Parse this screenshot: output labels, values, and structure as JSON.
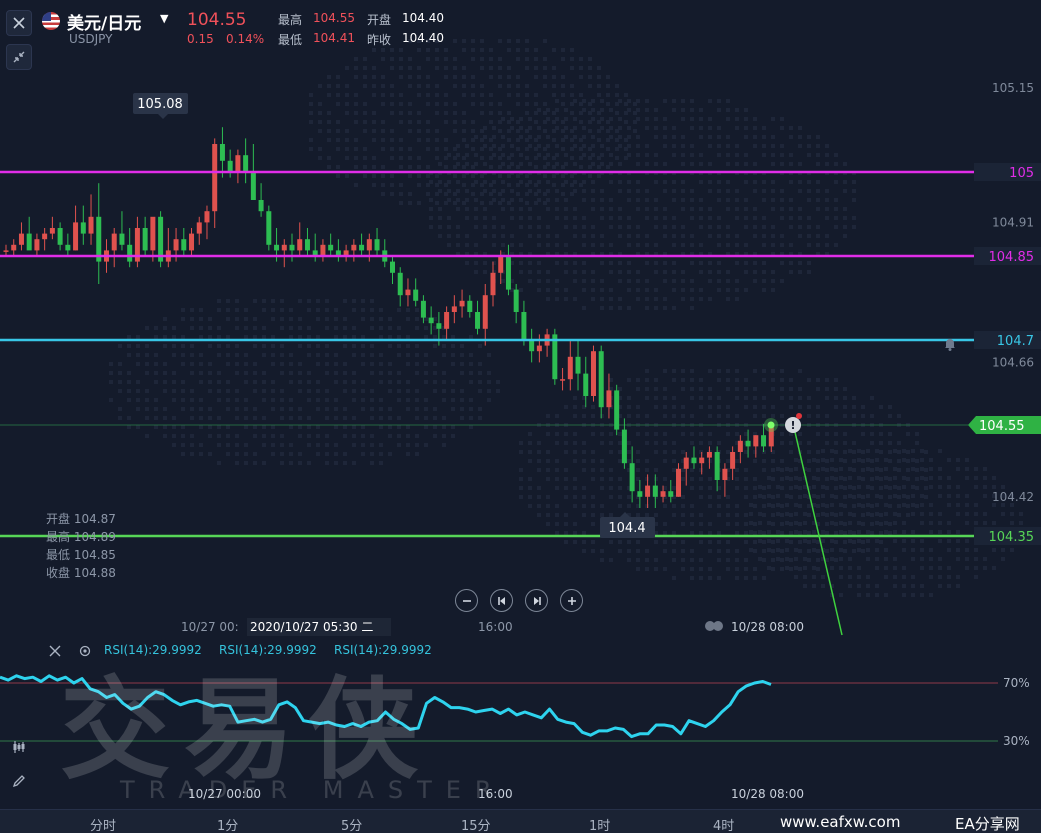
{
  "symbol": {
    "name": "美元/日元",
    "code": "USDJPY",
    "last_price": "104.55",
    "change": "0.15",
    "change_pct": "0.14%"
  },
  "stats": [
    {
      "label": "最高",
      "value": "104.55",
      "color": "#f0515a"
    },
    {
      "label": "开盘",
      "value": "104.40",
      "color": "#ffffff"
    },
    {
      "label": "最低",
      "value": "104.41",
      "color": "#f0515a"
    },
    {
      "label": "昨收",
      "value": "104.40",
      "color": "#ffffff"
    }
  ],
  "colors": {
    "up": "#e0524e",
    "down": "#2dbd52",
    "background": "#141b2b",
    "magenta_line": "#e02de8",
    "cyan_line": "#38c6e6",
    "green_line": "#57d657",
    "rsi": "#2ed3ee"
  },
  "price_axis": {
    "ticks": [
      "105.15",
      "104.91",
      "104.66",
      "104.42"
    ],
    "tick_values": [
      105.15,
      104.91,
      104.66,
      104.42
    ]
  },
  "h_lines": [
    {
      "label": "105",
      "value": 105.0,
      "color": "#e02de8"
    },
    {
      "label": "104.85",
      "value": 104.85,
      "color": "#e02de8"
    },
    {
      "label": "104.7",
      "value": 104.7,
      "color": "#38c6e6"
    },
    {
      "label": "104.35",
      "value": 104.35,
      "color": "#57d657"
    }
  ],
  "current_price_tag": "104.55",
  "high_marker": "105.08",
  "low_marker": "104.4",
  "ohlc": {
    "open": {
      "label": "开盘",
      "value": "104.87"
    },
    "high": {
      "label": "最高",
      "value": "104.89"
    },
    "low": {
      "label": "最低",
      "value": "104.85"
    },
    "close": {
      "label": "收盘",
      "value": "104.88"
    }
  },
  "time_axis": {
    "left": "10/27 00:",
    "cursor": "2020/10/27 05:30 二",
    "mid": "16:00",
    "right": "10/28 08:00"
  },
  "rsi": {
    "labels": [
      "RSI(14):29.9992",
      "RSI(14):29.9992",
      "RSI(14):29.9992"
    ],
    "levels": [
      "70%",
      "30%"
    ],
    "time_labels": [
      "10/27 00:00",
      "16:00",
      "10/28 08:00"
    ],
    "values": [
      74,
      72,
      75,
      73,
      74,
      71,
      75,
      72,
      74,
      70,
      73,
      66,
      64,
      60,
      62,
      56,
      52,
      54,
      60,
      64,
      62,
      58,
      55,
      57,
      58,
      56,
      54,
      55,
      54,
      43,
      44,
      45,
      43,
      45,
      55,
      57,
      53,
      44,
      43,
      42,
      43,
      41,
      40,
      42,
      40,
      43,
      44,
      50,
      45,
      42,
      38,
      39,
      56,
      60,
      57,
      53,
      53,
      52,
      50,
      51,
      52,
      49,
      52,
      48,
      50,
      48,
      46,
      52,
      45,
      43,
      42,
      36,
      34,
      37,
      37,
      39,
      38,
      33,
      35,
      35,
      41,
      41,
      40,
      35,
      44,
      42,
      40,
      44,
      50,
      55,
      64,
      68,
      70,
      71,
      69
    ]
  },
  "candles": [
    [
      104.86,
      104.87,
      104.85,
      104.86
    ],
    [
      104.86,
      104.88,
      104.85,
      104.87
    ],
    [
      104.87,
      104.91,
      104.86,
      104.89
    ],
    [
      104.89,
      104.92,
      104.87,
      104.86
    ],
    [
      104.86,
      104.89,
      104.85,
      104.88
    ],
    [
      104.88,
      104.9,
      104.86,
      104.89
    ],
    [
      104.89,
      104.92,
      104.88,
      104.9
    ],
    [
      104.9,
      104.91,
      104.86,
      104.87
    ],
    [
      104.87,
      104.89,
      104.85,
      104.86
    ],
    [
      104.86,
      104.94,
      104.86,
      104.91
    ],
    [
      104.91,
      104.94,
      104.87,
      104.89
    ],
    [
      104.89,
      104.96,
      104.87,
      104.92
    ],
    [
      104.92,
      104.98,
      104.8,
      104.84
    ],
    [
      104.84,
      104.88,
      104.82,
      104.86
    ],
    [
      104.86,
      104.9,
      104.83,
      104.89
    ],
    [
      104.89,
      104.93,
      104.86,
      104.87
    ],
    [
      104.87,
      104.9,
      104.83,
      104.84
    ],
    [
      104.84,
      104.92,
      104.83,
      104.9
    ],
    [
      104.9,
      104.92,
      104.85,
      104.86
    ],
    [
      104.86,
      104.91,
      104.84,
      104.92
    ],
    [
      104.92,
      104.93,
      104.83,
      104.84
    ],
    [
      104.84,
      104.9,
      104.83,
      104.86
    ],
    [
      104.86,
      104.9,
      104.84,
      104.88
    ],
    [
      104.88,
      104.9,
      104.85,
      104.86
    ],
    [
      104.86,
      104.9,
      104.85,
      104.89
    ],
    [
      104.89,
      104.92,
      104.87,
      104.91
    ],
    [
      104.91,
      104.94,
      104.88,
      104.93
    ],
    [
      104.93,
      105.06,
      104.9,
      105.05
    ],
    [
      105.05,
      105.08,
      104.99,
      105.02
    ],
    [
      105.02,
      105.04,
      104.99,
      105.0
    ],
    [
      105.0,
      105.04,
      104.98,
      105.03
    ],
    [
      105.03,
      105.06,
      104.98,
      105.0
    ],
    [
      105.0,
      105.05,
      104.95,
      104.95
    ],
    [
      104.95,
      104.98,
      104.92,
      104.93
    ],
    [
      104.93,
      104.94,
      104.86,
      104.87
    ],
    [
      104.87,
      104.9,
      104.84,
      104.86
    ],
    [
      104.86,
      104.88,
      104.83,
      104.87
    ],
    [
      104.87,
      104.89,
      104.84,
      104.86
    ],
    [
      104.86,
      104.91,
      104.85,
      104.88
    ],
    [
      104.88,
      104.9,
      104.85,
      104.86
    ],
    [
      104.86,
      104.89,
      104.84,
      104.85
    ],
    [
      104.85,
      104.88,
      104.84,
      104.87
    ],
    [
      104.87,
      104.89,
      104.85,
      104.86
    ],
    [
      104.86,
      104.88,
      104.84,
      104.85
    ],
    [
      104.85,
      104.87,
      104.84,
      104.86
    ],
    [
      104.86,
      104.88,
      104.84,
      104.87
    ],
    [
      104.87,
      104.89,
      104.85,
      104.86
    ],
    [
      104.86,
      104.89,
      104.84,
      104.88
    ],
    [
      104.88,
      104.9,
      104.85,
      104.86
    ],
    [
      104.86,
      104.88,
      104.83,
      104.84
    ],
    [
      104.84,
      104.85,
      104.8,
      104.82
    ],
    [
      104.82,
      104.83,
      104.76,
      104.78
    ],
    [
      104.78,
      104.81,
      104.76,
      104.79
    ],
    [
      104.79,
      104.81,
      104.76,
      104.77
    ],
    [
      104.77,
      104.78,
      104.73,
      104.74
    ],
    [
      104.74,
      104.76,
      104.71,
      104.73
    ],
    [
      104.73,
      104.75,
      104.69,
      104.72
    ],
    [
      104.72,
      104.76,
      104.7,
      104.75
    ],
    [
      104.75,
      104.78,
      104.73,
      104.76
    ],
    [
      104.76,
      104.79,
      104.74,
      104.77
    ],
    [
      104.77,
      104.78,
      104.74,
      104.75
    ],
    [
      104.75,
      104.77,
      104.71,
      104.72
    ],
    [
      104.72,
      104.8,
      104.69,
      104.78
    ],
    [
      104.78,
      104.84,
      104.76,
      104.82
    ],
    [
      104.82,
      104.86,
      104.8,
      104.85
    ],
    [
      104.85,
      104.87,
      104.78,
      104.79
    ],
    [
      104.79,
      104.8,
      104.73,
      104.75
    ],
    [
      104.75,
      104.77,
      104.69,
      104.7
    ],
    [
      104.7,
      104.72,
      104.66,
      104.68
    ],
    [
      104.68,
      104.71,
      104.66,
      104.69
    ],
    [
      104.69,
      104.72,
      104.67,
      104.71
    ],
    [
      104.71,
      104.72,
      104.62,
      104.63
    ],
    [
      104.63,
      104.65,
      104.61,
      104.63
    ],
    [
      104.63,
      104.7,
      104.61,
      104.67
    ],
    [
      104.67,
      104.7,
      104.61,
      104.64
    ],
    [
      104.64,
      104.67,
      104.58,
      104.6
    ],
    [
      104.6,
      104.69,
      104.59,
      104.68
    ],
    [
      104.68,
      104.69,
      104.56,
      104.58
    ],
    [
      104.58,
      104.64,
      104.56,
      104.61
    ],
    [
      104.61,
      104.62,
      104.53,
      104.54
    ],
    [
      104.54,
      104.56,
      104.47,
      104.48
    ],
    [
      104.48,
      104.51,
      104.41,
      104.43
    ],
    [
      104.43,
      104.45,
      104.4,
      104.42
    ],
    [
      104.42,
      104.46,
      104.4,
      104.44
    ],
    [
      104.44,
      104.46,
      104.4,
      104.42
    ],
    [
      104.42,
      104.44,
      104.41,
      104.43
    ],
    [
      104.43,
      104.45,
      104.41,
      104.42
    ],
    [
      104.42,
      104.48,
      104.42,
      104.47
    ],
    [
      104.47,
      104.5,
      104.44,
      104.49
    ],
    [
      104.49,
      104.51,
      104.47,
      104.48
    ],
    [
      104.48,
      104.5,
      104.46,
      104.49
    ],
    [
      104.49,
      104.51,
      104.47,
      104.5
    ],
    [
      104.5,
      104.51,
      104.43,
      104.45
    ],
    [
      104.45,
      104.48,
      104.42,
      104.47
    ],
    [
      104.47,
      104.51,
      104.45,
      104.5
    ],
    [
      104.5,
      104.53,
      104.48,
      104.52
    ],
    [
      104.52,
      104.54,
      104.49,
      104.51
    ],
    [
      104.51,
      104.53,
      104.49,
      104.53
    ],
    [
      104.53,
      104.55,
      104.5,
      104.51
    ],
    [
      104.51,
      104.55,
      104.5,
      104.55
    ]
  ],
  "timeframes": [
    "分时",
    "1分",
    "5分",
    "15分",
    "1时",
    "4时"
  ],
  "site": {
    "url": "www.eafxw.com",
    "name": "EA分享网"
  },
  "watermark": {
    "big": "交易侠",
    "sub": "TRADER MASTER"
  }
}
